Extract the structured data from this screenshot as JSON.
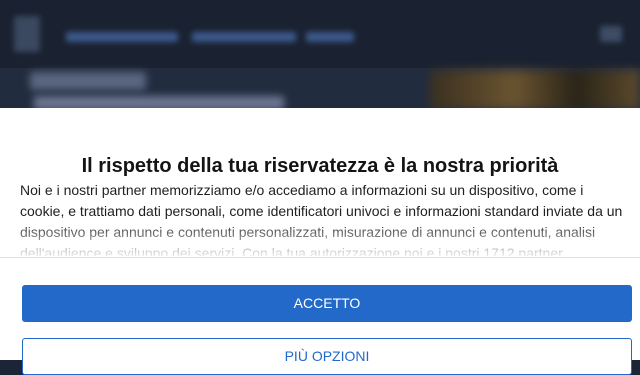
{
  "consent": {
    "title": "Il rispetto della tua riservatezza è la nostra priorità",
    "body": "Noi e i nostri partner memorizziamo e/o accediamo a informazioni su un dispositivo, come i cookie, e trattiamo dati personali, come identificatori univoci e informazioni standard inviate da un dispositivo per annunci e contenuti personalizzati, misurazione di annunci e contenuti, analisi dell'audience e sviluppo dei servizi. Con la tua autorizzazione noi e i nostri 1712 partner",
    "accept_label": "ACCETTO",
    "more_options_label": "PIÙ OPZIONI",
    "accent_color": "#2269c9"
  },
  "background": {
    "icons": [
      "site-logo-icon",
      "menu-icon"
    ]
  }
}
